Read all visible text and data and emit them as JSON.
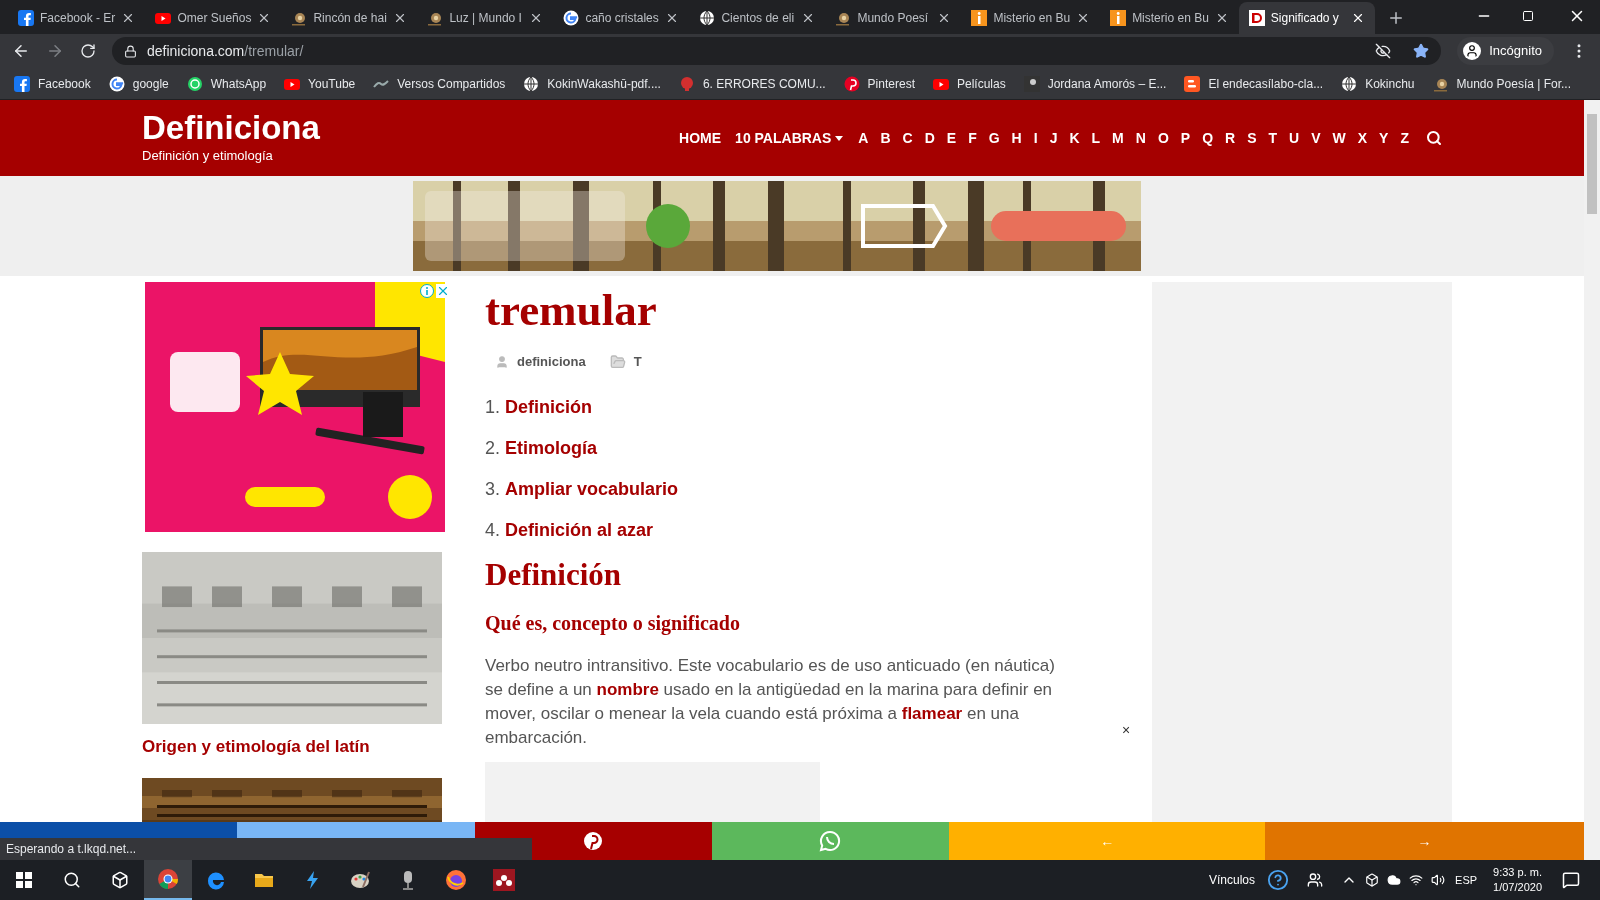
{
  "browser": {
    "tabs": [
      {
        "title": "Facebook - Er",
        "kind": "facebook",
        "selected": false
      },
      {
        "title": "Omer Sueños",
        "kind": "youtube",
        "selected": false
      },
      {
        "title": "Rincón de hai",
        "kind": "snail",
        "selected": false
      },
      {
        "title": "Luz | Mundo I",
        "kind": "snail",
        "selected": false
      },
      {
        "title": "caño cristales",
        "kind": "google",
        "selected": false
      },
      {
        "title": "Cientos de eli",
        "kind": "globe",
        "selected": false
      },
      {
        "title": "Mundo Poesí",
        "kind": "snail",
        "selected": false
      },
      {
        "title": "Misterio en Bu",
        "kind": "info",
        "selected": false
      },
      {
        "title": "Misterio en Bu",
        "kind": "info",
        "selected": false
      },
      {
        "title": "Significado y",
        "kind": "definiciona",
        "selected": true
      }
    ],
    "address": {
      "domain": "definiciona.com",
      "path": "/tremular/"
    },
    "profile": "Incógnito",
    "bookmarks": [
      {
        "label": "Facebook",
        "kind": "facebook"
      },
      {
        "label": "google",
        "kind": "google"
      },
      {
        "label": "WhatsApp",
        "kind": "whatsapp"
      },
      {
        "label": "YouTube",
        "kind": "youtube"
      },
      {
        "label": "Versos Compartidos",
        "kind": "scribble"
      },
      {
        "label": "KokinWakashū-pdf....",
        "kind": "globe"
      },
      {
        "label": "6. ERRORES COMU...",
        "kind": "drop"
      },
      {
        "label": "Pinterest",
        "kind": "pinterest"
      },
      {
        "label": "Películas",
        "kind": "youtube"
      },
      {
        "label": "Jordana Amorós – E..."
      },
      {
        "label": "El endecasílabo-cla...",
        "kind": "blogger"
      },
      {
        "label": "Kokinchu",
        "kind": "globe"
      },
      {
        "label": "Mundo Poesía | For...",
        "kind": "snail"
      }
    ],
    "status": "Esperando a t.lkqd.net..."
  },
  "site": {
    "title": "Definiciona",
    "tagline": "Definición y etimología",
    "nav": [
      {
        "label": "HOME",
        "dropdown": false
      },
      {
        "label": "10 PALABRAS",
        "dropdown": true
      }
    ],
    "letters": [
      "A",
      "B",
      "C",
      "D",
      "E",
      "F",
      "G",
      "H",
      "I",
      "J",
      "K",
      "L",
      "M",
      "N",
      "O",
      "P",
      "Q",
      "R",
      "S",
      "T",
      "U",
      "V",
      "W",
      "X",
      "Y",
      "Z"
    ]
  },
  "sidebar": {
    "caption": "Origen y etimología del latín"
  },
  "article": {
    "title": "tremular",
    "author": "definiciona",
    "category": "T",
    "toc": [
      {
        "number": "1.",
        "label": "Definición"
      },
      {
        "number": "2.",
        "label": "Etimología"
      },
      {
        "number": "3.",
        "label": "Ampliar vocabulario"
      },
      {
        "number": "4.",
        "label": "Definición al azar"
      }
    ],
    "heading": "Definición",
    "subheading": "Qué es, concepto o significado",
    "paragraph": "Verbo neutro intransitivo. Este vocabulario es de uso anticuado (en náutica) se define a un **nombre** usado en la antigüedad en la marina para definir en mover, oscilar o menear la vela cuando está próxima a **flamear** en una embarcación.",
    "ad_close": "×"
  },
  "share_bar": [
    {
      "kind": "facebook"
    },
    {
      "kind": "twitter"
    },
    {
      "kind": "pinterest"
    },
    {
      "kind": "whatsapp"
    },
    {
      "kind": "prev",
      "label": "←"
    },
    {
      "kind": "next",
      "label": "→"
    }
  ],
  "taskbar": {
    "apps": [
      {
        "kind": "chrome",
        "selected": true
      },
      {
        "kind": "edge",
        "selected": false
      },
      {
        "kind": "folder",
        "selected": false
      },
      {
        "kind": "bolt",
        "selected": false
      },
      {
        "kind": "paint",
        "selected": false
      },
      {
        "kind": "mic",
        "selected": false
      },
      {
        "kind": "firefox",
        "selected": false
      },
      {
        "kind": "mendeley",
        "selected": false
      }
    ],
    "links_label": "Vínculos",
    "language": "ESP",
    "time": "9:33 p. m.",
    "date": "1/07/2020"
  }
}
